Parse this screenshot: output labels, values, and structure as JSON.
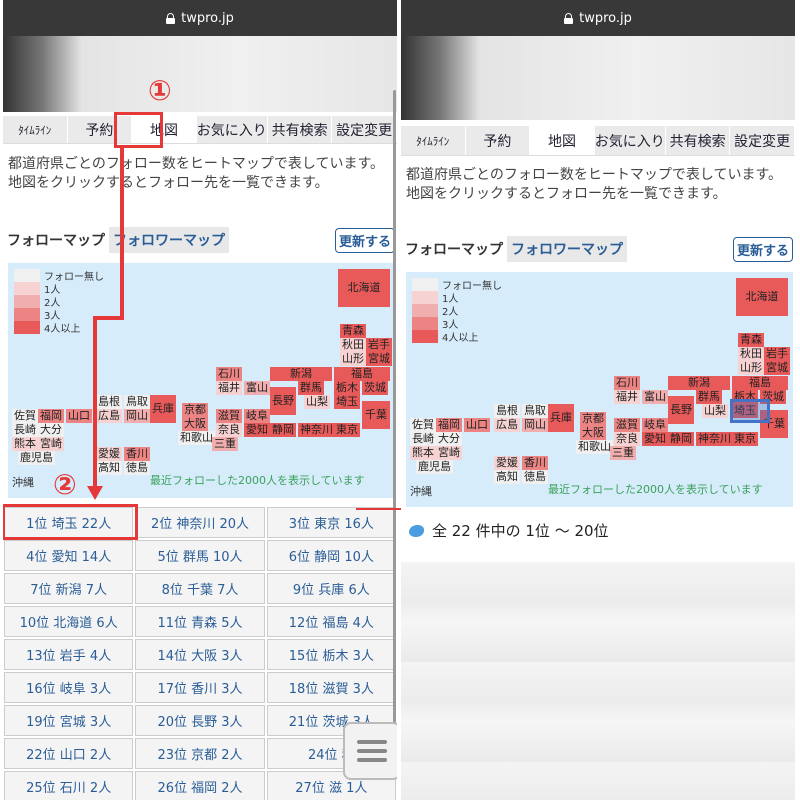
{
  "url": "twpro.jp",
  "tabs": [
    {
      "label": "ﾀｲﾑﾗｲﾝ",
      "small": true
    },
    {
      "label": "予約"
    },
    {
      "label": "地図"
    },
    {
      "label": "お気に入り"
    },
    {
      "label": "共有検索"
    },
    {
      "label": "設定変更"
    }
  ],
  "description": "都道府県ごとのフォロー数をヒートマップで表しています。地図をクリックするとフォロー先を一覧できます。",
  "map_tabs": {
    "follow": "フォローマップ",
    "follower": "フォロワーマップ",
    "refresh": "更新する"
  },
  "legend": [
    "フォロー無し",
    "1人",
    "2人",
    "3人",
    "4人以上"
  ],
  "legend_colors": [
    "#f0f0f0",
    "#f7d2d2",
    "#f1aeae",
    "#ec8484",
    "#e85a5a"
  ],
  "map_note": "最近フォローした2000人を表示しています",
  "okinawa": "沖縄",
  "prefectures": [
    {
      "name": "北海道",
      "level": 4
    },
    {
      "name": "青森",
      "level": 4
    },
    {
      "name": "秋田",
      "level": 1
    },
    {
      "name": "岩手",
      "level": 4
    },
    {
      "name": "山形",
      "level": 1
    },
    {
      "name": "宮城",
      "level": 4
    },
    {
      "name": "石川",
      "level": 3
    },
    {
      "name": "新潟",
      "level": 4
    },
    {
      "name": "福島",
      "level": 4
    },
    {
      "name": "福井",
      "level": 1
    },
    {
      "name": "富山",
      "level": 2
    },
    {
      "name": "群馬",
      "level": 4
    },
    {
      "name": "栃木",
      "level": 4
    },
    {
      "name": "茨城",
      "level": 4
    },
    {
      "name": "島根",
      "level": 0
    },
    {
      "name": "鳥取",
      "level": 0
    },
    {
      "name": "兵庫",
      "level": 4
    },
    {
      "name": "京都",
      "level": 3
    },
    {
      "name": "滋賀",
      "level": 3
    },
    {
      "name": "岐阜",
      "level": 3
    },
    {
      "name": "長野",
      "level": 4
    },
    {
      "name": "山梨",
      "level": 1
    },
    {
      "name": "埼玉",
      "level": 4
    },
    {
      "name": "千葉",
      "level": 4
    },
    {
      "name": "佐賀",
      "level": 0
    },
    {
      "name": "福岡",
      "level": 3
    },
    {
      "name": "山口",
      "level": 3
    },
    {
      "name": "広島",
      "level": 1
    },
    {
      "name": "岡山",
      "level": 2
    },
    {
      "name": "大阪",
      "level": 3
    },
    {
      "name": "奈良",
      "level": 1
    },
    {
      "name": "愛知",
      "level": 4
    },
    {
      "name": "静岡",
      "level": 4
    },
    {
      "name": "神奈川",
      "level": 4
    },
    {
      "name": "東京",
      "level": 4
    },
    {
      "name": "長崎",
      "level": 0
    },
    {
      "name": "大分",
      "level": 0
    },
    {
      "name": "和歌山",
      "level": 0
    },
    {
      "name": "三重",
      "level": 2
    },
    {
      "name": "熊本",
      "level": 1
    },
    {
      "name": "宮崎",
      "level": 1
    },
    {
      "name": "愛媛",
      "level": 1
    },
    {
      "name": "香川",
      "level": 3
    },
    {
      "name": "鹿児島",
      "level": 0
    },
    {
      "name": "高知",
      "level": 0
    },
    {
      "name": "徳島",
      "level": 0
    }
  ],
  "ranking": [
    "1位 埼玉 22人",
    "2位 神奈川 20人",
    "3位 東京 16人",
    "4位 愛知 14人",
    "5位 群馬 10人",
    "6位 静岡 10人",
    "7位 新潟 7人",
    "8位 千葉 7人",
    "9位 兵庫 6人",
    "10位 北海道 6人",
    "11位 青森 5人",
    "12位 福島 4人",
    "13位 岩手 4人",
    "14位 大阪 3人",
    "15位 栃木 3人",
    "16位 岐阜 3人",
    "17位 香川 3人",
    "18位 滋賀 3人",
    "19位 宮城 3人",
    "20位 長野 3人",
    "21位 茨城 3人",
    "22位 山口 2人",
    "23位 京都 2人",
    "24位 秋",
    "25位 石川 2人",
    "26位 福岡 2人",
    "27位 滋 1人"
  ],
  "annotations": {
    "step1": "①",
    "step2": "②"
  },
  "result_text": "全 22 件中の 1位 〜 20位",
  "colors": {
    "accent": "#e53838",
    "link": "#2a5d96",
    "map_bg": "#d6ecfb",
    "selected": "#4472c4"
  }
}
